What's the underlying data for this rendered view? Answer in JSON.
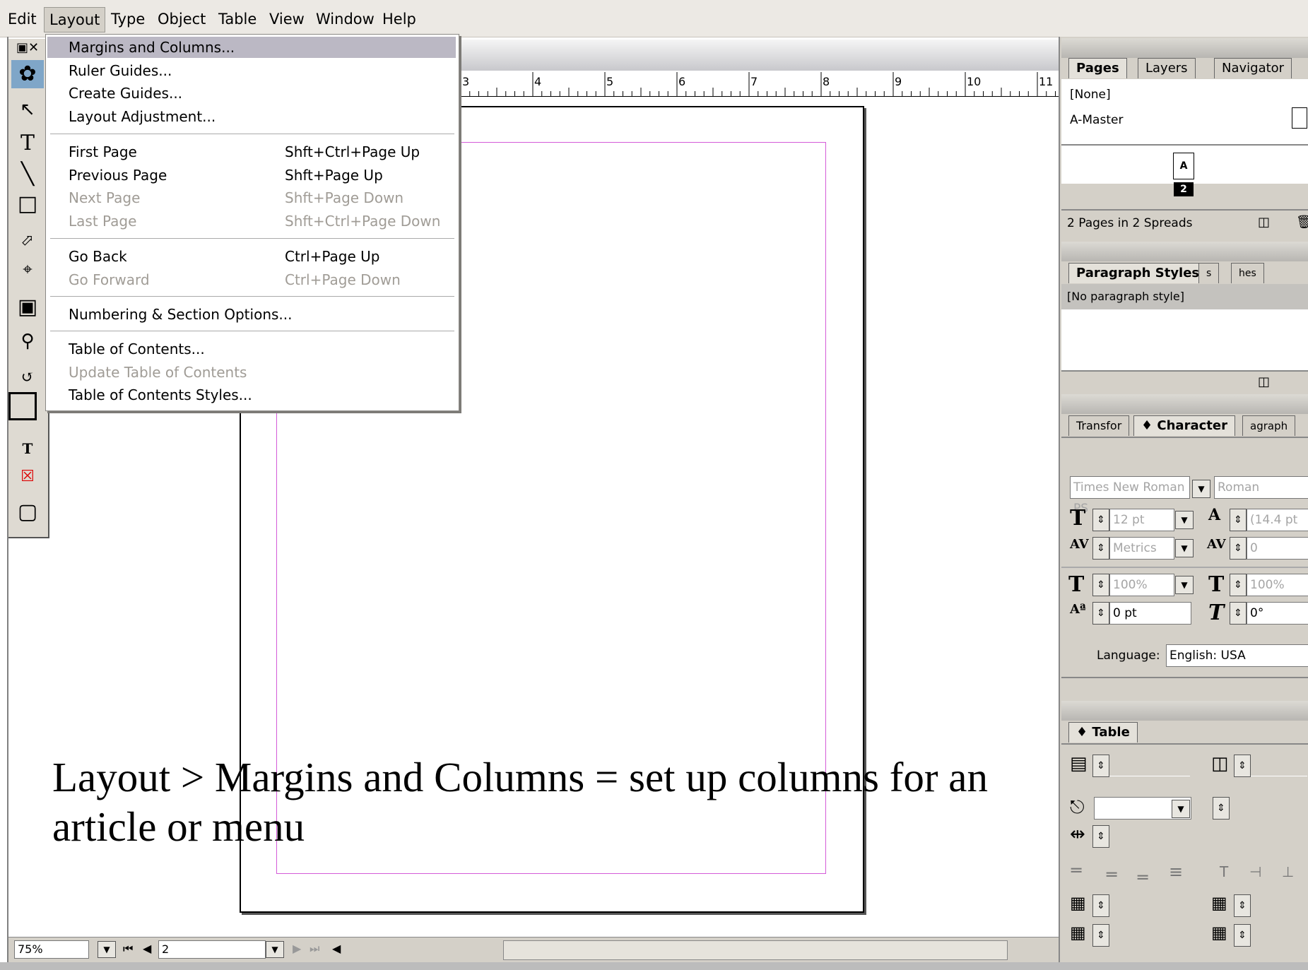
{
  "menubar": {
    "items": [
      "Edit",
      "Layout",
      "Type",
      "Object",
      "Table",
      "View",
      "Window",
      "Help"
    ]
  },
  "layout_menu": {
    "items": [
      {
        "label": "Margins and Columns...",
        "shortcut": "",
        "highlighted": true,
        "disabled": false
      },
      {
        "label": "Ruler Guides...",
        "shortcut": "",
        "disabled": false
      },
      {
        "label": "Create Guides...",
        "shortcut": "",
        "disabled": false
      },
      {
        "label": "Layout Adjustment...",
        "shortcut": "",
        "disabled": false
      },
      {
        "label": "First Page",
        "shortcut": "Shft+Ctrl+Page Up",
        "disabled": false
      },
      {
        "label": "Previous Page",
        "shortcut": "Shft+Page Up",
        "disabled": false
      },
      {
        "label": "Next Page",
        "shortcut": "Shft+Page Down",
        "disabled": true
      },
      {
        "label": "Last Page",
        "shortcut": "Shft+Ctrl+Page Down",
        "disabled": true
      },
      {
        "label": "Go Back",
        "shortcut": "Ctrl+Page Up",
        "disabled": false
      },
      {
        "label": "Go Forward",
        "shortcut": "Ctrl+Page Down",
        "disabled": true
      },
      {
        "label": "Numbering & Section Options...",
        "shortcut": "",
        "disabled": false
      },
      {
        "label": "Table of Contents...",
        "shortcut": "",
        "disabled": false
      },
      {
        "label": "Update Table of Contents",
        "shortcut": "",
        "disabled": true
      },
      {
        "label": "Table of Contents Styles...",
        "shortcut": "",
        "disabled": false
      }
    ]
  },
  "ruler": {
    "numbers": [
      "3",
      "4",
      "5",
      "6",
      "7",
      "8",
      "9",
      "10",
      "11"
    ]
  },
  "pages_panel": {
    "tabs": [
      "Pages",
      "Layers",
      "Navigator"
    ],
    "none_label": "[None]",
    "master_label": "A-Master",
    "master_thumb_letter": "A",
    "page_number": "2",
    "status": "2 Pages in 2 Spreads"
  },
  "paragraph_panel": {
    "tabs": [
      "Paragraph Styles",
      "s",
      "hes"
    ],
    "selected_style": "[No paragraph style]"
  },
  "character_panel": {
    "tabs": [
      "Transfor",
      "♦ Character",
      "agraph"
    ],
    "font": "Times New Roman PS",
    "style": "Roman",
    "size": "12 pt",
    "leading": "(14.4 pt",
    "kerning": "Metrics",
    "tracking": "0",
    "vscale": "100%",
    "hscale": "100%",
    "baseline": "0 pt",
    "skew": "0°",
    "language_label": "Language:",
    "language": "English: USA"
  },
  "table_panel": {
    "tab": "♦ Table"
  },
  "statusbar": {
    "zoom": "75%",
    "page": "2"
  },
  "caption": {
    "line1": "Layout > Margins and Columns = set up columns for an",
    "line2": "article or menu"
  },
  "colors": {
    "margin_guide": "#d45bd8",
    "menu_highlight": "#bbb8c4",
    "disabled_text": "#a09c96"
  }
}
